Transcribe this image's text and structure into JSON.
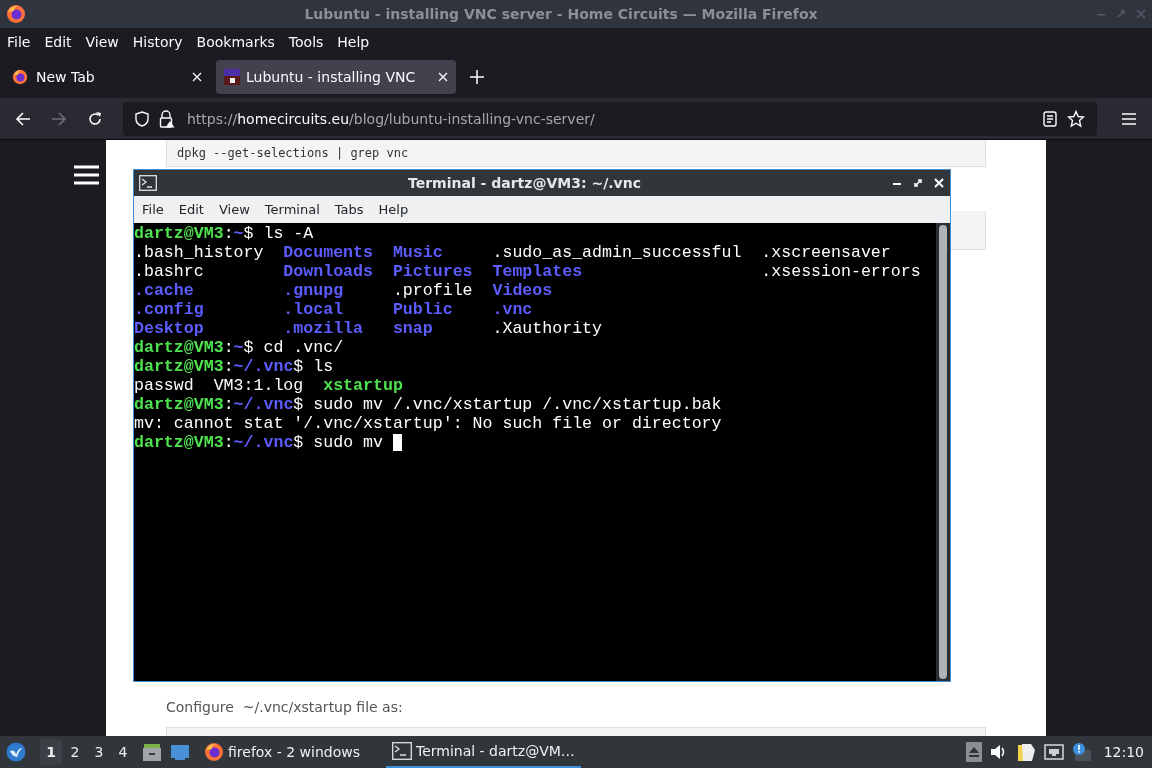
{
  "window": {
    "title": "Lubuntu - installing VNC server - Home Circuits — Mozilla Firefox"
  },
  "menu": [
    "File",
    "Edit",
    "View",
    "History",
    "Bookmarks",
    "Tools",
    "Help"
  ],
  "tabs": [
    {
      "label": "New Tab",
      "selected": false,
      "kind": "firefox"
    },
    {
      "label": "Lubuntu - installing VNC",
      "selected": true,
      "kind": "site"
    }
  ],
  "url": [
    {
      "text": "https://",
      "kind": "dim"
    },
    {
      "text": "homecircuits.eu",
      "kind": "host"
    },
    {
      "text": "/blog/lubuntu-installing-vnc-server/",
      "kind": "dim"
    }
  ],
  "page": {
    "code_top": "dpkg --get-selections | grep vnc",
    "paragraph": "Configure  ~/.vnc/xstartup file as:"
  },
  "terminal": {
    "title": "Terminal - dartz@VM3: ~/.vnc",
    "menu": [
      "File",
      "Edit",
      "View",
      "Terminal",
      "Tabs",
      "Help"
    ],
    "lines": [
      {
        "kind": "segments",
        "segments": [
          {
            "text": "dartz@VM3",
            "kind": "user"
          },
          {
            "text": ":",
            "kind": "plain"
          },
          {
            "text": "~",
            "kind": "path"
          },
          {
            "text": "$ ls -A",
            "kind": "plain"
          }
        ]
      },
      {
        "kind": "listing",
        "cells": [
          {
            "text": ".bash_history",
            "kind": "file"
          },
          {
            "text": "Documents",
            "kind": "dir"
          },
          {
            "text": "Music",
            "kind": "dir"
          },
          {
            "text": ".sudo_as_admin_successful",
            "kind": "file"
          },
          {
            "text": ".xscreensaver",
            "kind": "file"
          }
        ]
      },
      {
        "kind": "listing",
        "cells": [
          {
            "text": ".bashrc",
            "kind": "file"
          },
          {
            "text": "Downloads",
            "kind": "dir"
          },
          {
            "text": "Pictures",
            "kind": "dir"
          },
          {
            "text": "Templates",
            "kind": "dir"
          },
          {
            "text": ".xsession-errors",
            "kind": "file"
          }
        ]
      },
      {
        "kind": "listing",
        "cells": [
          {
            "text": ".cache",
            "kind": "dir"
          },
          {
            "text": ".gnupg",
            "kind": "dir"
          },
          {
            "text": ".profile",
            "kind": "file"
          },
          {
            "text": "Videos",
            "kind": "dir"
          }
        ]
      },
      {
        "kind": "listing",
        "cells": [
          {
            "text": ".config",
            "kind": "dir"
          },
          {
            "text": ".local",
            "kind": "dir"
          },
          {
            "text": "Public",
            "kind": "dir"
          },
          {
            "text": ".vnc",
            "kind": "dir"
          }
        ]
      },
      {
        "kind": "listing",
        "cells": [
          {
            "text": "Desktop",
            "kind": "dir"
          },
          {
            "text": ".mozilla",
            "kind": "dir"
          },
          {
            "text": "snap",
            "kind": "dir"
          },
          {
            "text": ".Xauthority",
            "kind": "file"
          }
        ]
      },
      {
        "kind": "segments",
        "segments": [
          {
            "text": "dartz@VM3",
            "kind": "user"
          },
          {
            "text": ":",
            "kind": "plain"
          },
          {
            "text": "~",
            "kind": "path"
          },
          {
            "text": "$ cd .vnc/",
            "kind": "plain"
          }
        ]
      },
      {
        "kind": "segments",
        "segments": [
          {
            "text": "dartz@VM3",
            "kind": "user"
          },
          {
            "text": ":",
            "kind": "plain"
          },
          {
            "text": "~/.vnc",
            "kind": "path"
          },
          {
            "text": "$ ls",
            "kind": "plain"
          }
        ]
      },
      {
        "kind": "segments",
        "segments": [
          {
            "text": "passwd  VM3:1.log",
            "kind": "plain"
          },
          {
            "text": "xstartup",
            "kind": "exec"
          }
        ]
      },
      {
        "kind": "segments",
        "segments": [
          {
            "text": "dartz@VM3",
            "kind": "user"
          },
          {
            "text": ":",
            "kind": "plain"
          },
          {
            "text": "~/.vnc",
            "kind": "path"
          },
          {
            "text": "$ sudo mv /.vnc/xstartup /.vnc/xstartup.bak",
            "kind": "plain"
          }
        ]
      },
      {
        "kind": "segments",
        "segments": [
          {
            "text": "mv: cannot stat '/.vnc/xstartup': No such file or directory",
            "kind": "plain"
          }
        ]
      },
      {
        "kind": "segments",
        "cursor": true,
        "segments": [
          {
            "text": "dartz@VM3",
            "kind": "user"
          },
          {
            "text": ":",
            "kind": "plain"
          },
          {
            "text": "~/.vnc",
            "kind": "path"
          },
          {
            "text": "$ sudo mv",
            "kind": "plain"
          }
        ]
      }
    ]
  },
  "taskbar": {
    "workspaces": [
      {
        "label": "1",
        "selected": true
      },
      {
        "label": "2",
        "selected": false
      },
      {
        "label": "3",
        "selected": false
      },
      {
        "label": "4",
        "selected": false
      }
    ],
    "tasks": [
      {
        "label": "firefox - 2 windows",
        "kind": "firefox",
        "selected": false
      },
      {
        "label": "Terminal - dartz@VM…",
        "kind": "terminal",
        "selected": true
      }
    ],
    "clock": "12:10"
  }
}
